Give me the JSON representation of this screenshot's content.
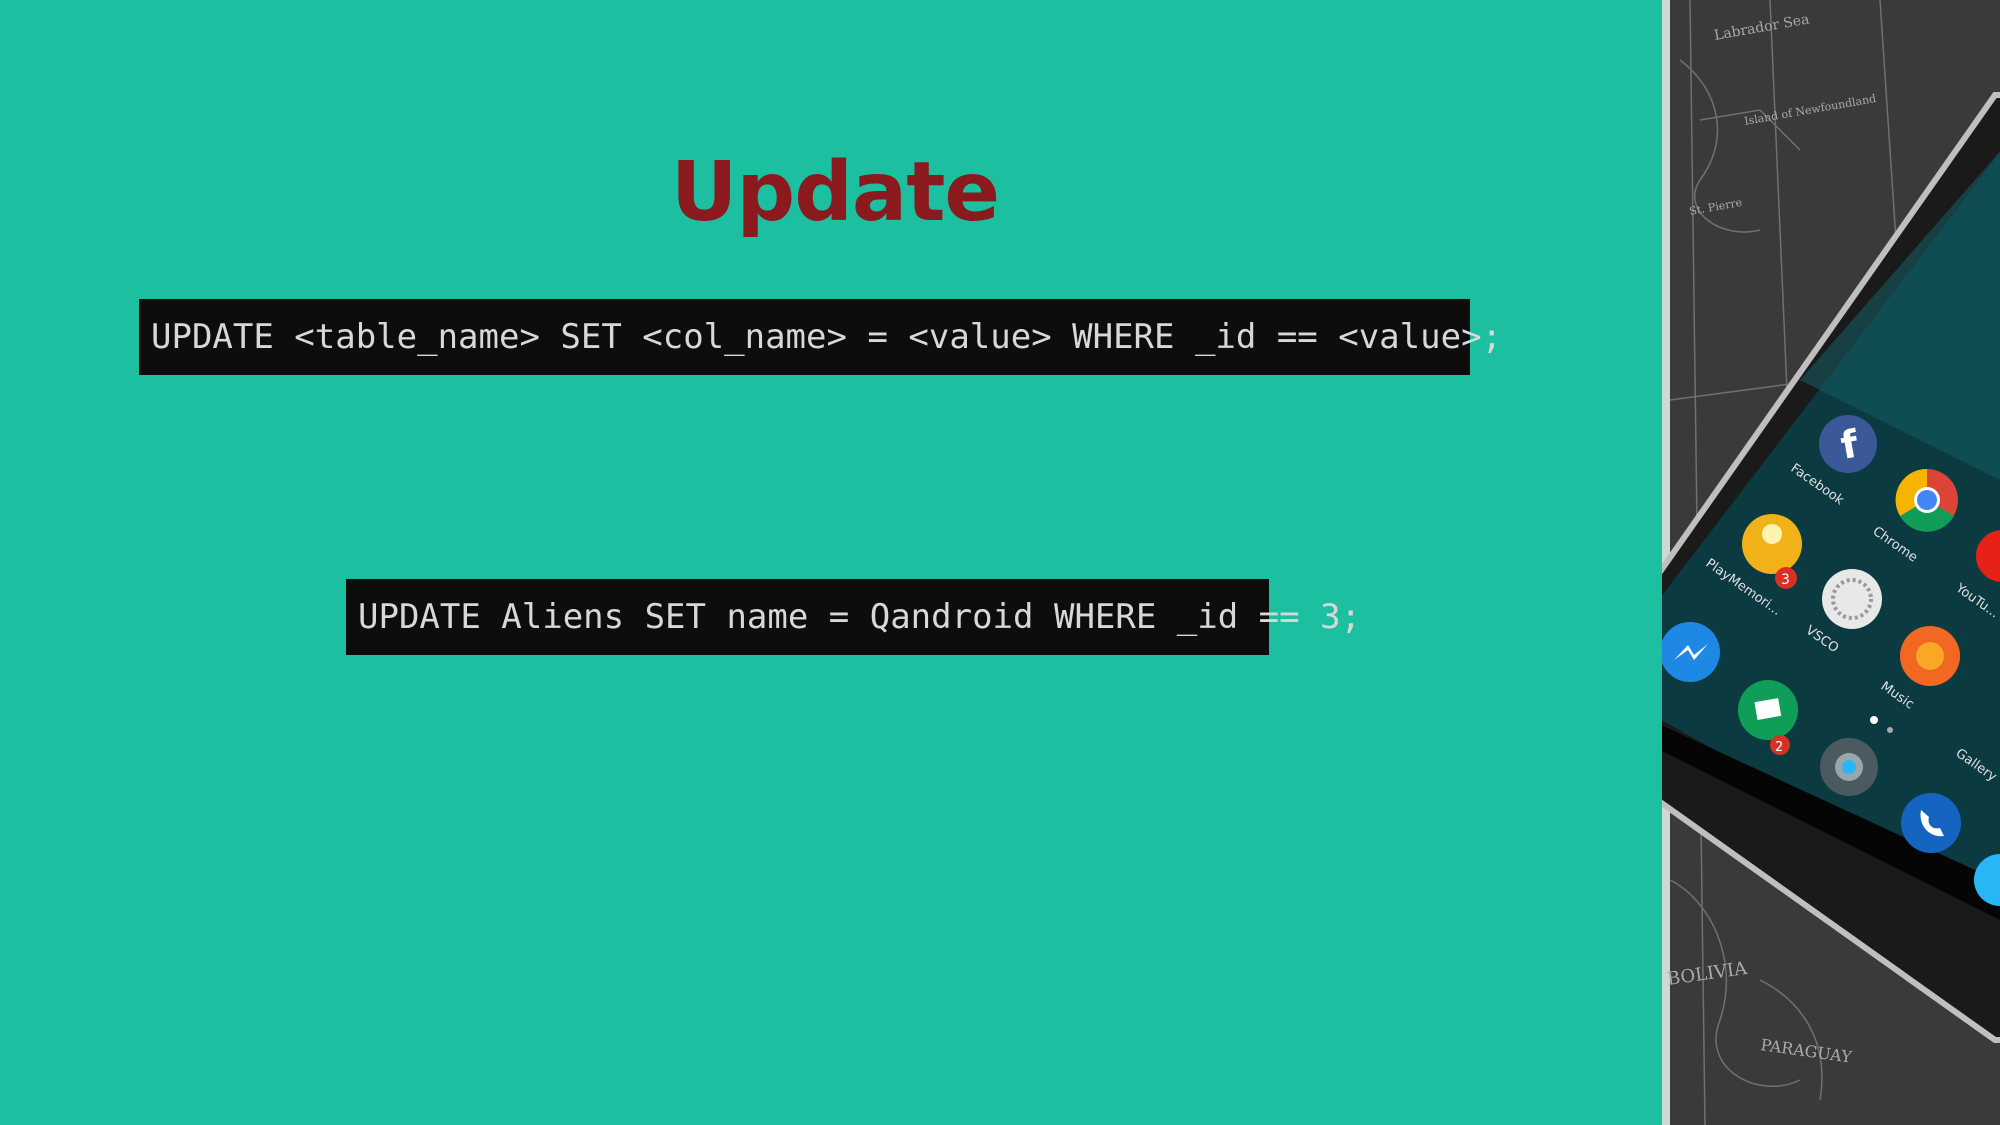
{
  "slide": {
    "title": "Update",
    "background_color": "#1cbfa0",
    "title_color": "#8b1a1e",
    "code_blocks": [
      "UPDATE <table_name> SET <col_name> = <value> WHERE _id == <value>;",
      "UPDATE Aliens SET name = Qandroid WHERE _id == 3;"
    ]
  },
  "photo": {
    "map_labels": [
      "Labrador Sea",
      "Island of Newfoundland",
      "St. Pierre",
      "BOLIVIA",
      "PARAGUAY"
    ],
    "app_labels": [
      "Facebook",
      "Chrome",
      "PlayMemori...",
      "VSCO",
      "Music",
      "YouTu...",
      "Gallery"
    ],
    "badges": [
      "3",
      "2"
    ]
  }
}
